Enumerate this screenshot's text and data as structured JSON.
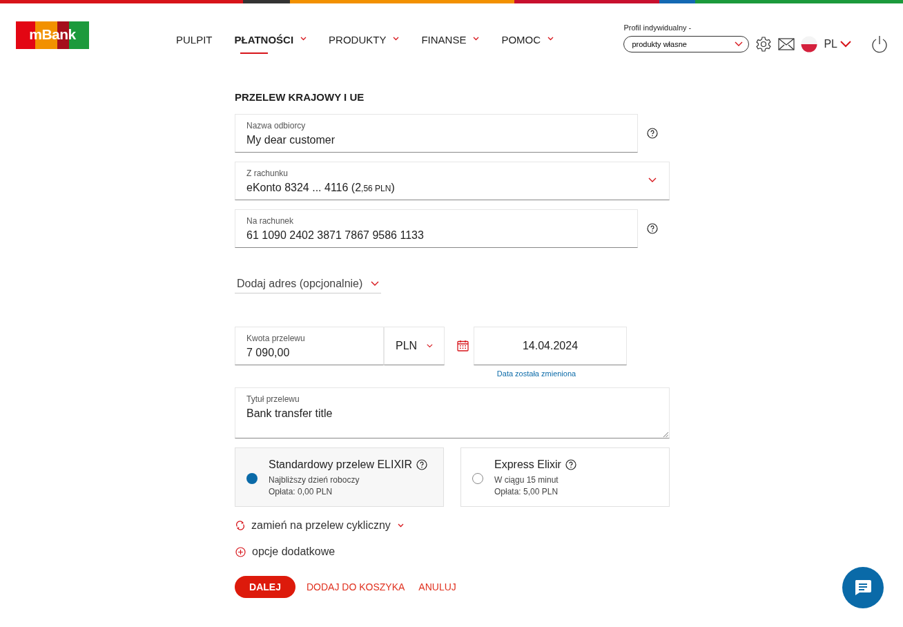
{
  "header": {
    "logo": "mBank",
    "nav": [
      {
        "label": "PULPIT",
        "selected": false,
        "dropdown": false
      },
      {
        "label": "PŁATNOŚCI",
        "selected": true,
        "dropdown": true
      },
      {
        "label": "PRODUKTY",
        "selected": false,
        "dropdown": true
      },
      {
        "label": "FINANSE",
        "selected": false,
        "dropdown": true
      },
      {
        "label": "POMOC",
        "selected": false,
        "dropdown": true
      }
    ],
    "profile_label": "Profil indywidualny -",
    "profile_select": "produkty własne",
    "language": "PL"
  },
  "form": {
    "title": "PRZELEW KRAJOWY I UE",
    "recipient": {
      "label": "Nazwa odbiorcy",
      "value": "My dear customer"
    },
    "from_account": {
      "label": "Z rachunku",
      "value": "eKonto 8324 ... 4116 (2",
      "value_small": ",56 PLN",
      "value_end": ")"
    },
    "to_account": {
      "label": "Na rachunek",
      "value": "61 1090 2402 3871 7867 9586 1133"
    },
    "address_toggle": "Dodaj adres (opcjonalnie)",
    "amount": {
      "label": "Kwota przelewu",
      "value": "7 090,00"
    },
    "currency": "PLN",
    "date": {
      "value": "14.04.2024",
      "note": "Data została zmieniona"
    },
    "title_field": {
      "label": "Tytuł przelewu",
      "value": "Bank transfer title"
    },
    "transfer_types": [
      {
        "name": "Standardowy przelew ELIXIR",
        "detail": "Najbliższy dzień roboczy",
        "fee": "Opłata: 0,00 PLN",
        "selected": true
      },
      {
        "name": "Express Elixir",
        "detail": "W ciągu 15 minut",
        "fee": "Opłata: 5,00 PLN",
        "selected": false
      }
    ],
    "recurring": "zamień na przelew cykliczny",
    "extra_options": "opcje dodatkowe",
    "buttons": {
      "next": "DALEJ",
      "add_to_cart": "DODAJ DO KOSZYKA",
      "cancel": "ANULUJ"
    }
  }
}
